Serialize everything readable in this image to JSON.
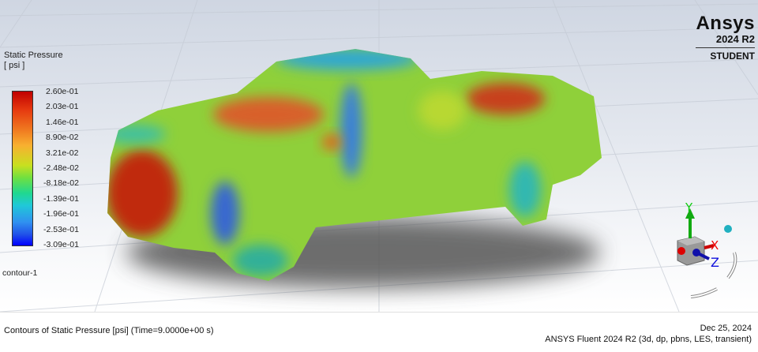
{
  "legend": {
    "title": "Static Pressure",
    "units": "[ psi ]",
    "ticks": [
      "2.60e-01",
      "2.03e-01",
      "1.46e-01",
      "8.90e-02",
      "3.21e-02",
      "-2.48e-02",
      "-8.18e-02",
      "-1.39e-01",
      "-1.96e-01",
      "-2.53e-01",
      "-3.09e-01"
    ],
    "range": [
      -0.309,
      0.26
    ],
    "colors": {
      "max": "#c00000",
      "min": "#0000ff"
    }
  },
  "contour_name": "contour-1",
  "logo": {
    "word": "Ansys",
    "version": "2024 R2",
    "edition": "STUDENT"
  },
  "triad": {
    "x": "X",
    "y": "Y",
    "z": "Z"
  },
  "footer": {
    "caption": "Contours of Static Pressure [psi]  (Time=9.0000e+00 s)",
    "date": "Dec 25, 2024",
    "solver": "ANSYS Fluent 2024 R2 (3d, dp, pbns, LES, transient)"
  }
}
